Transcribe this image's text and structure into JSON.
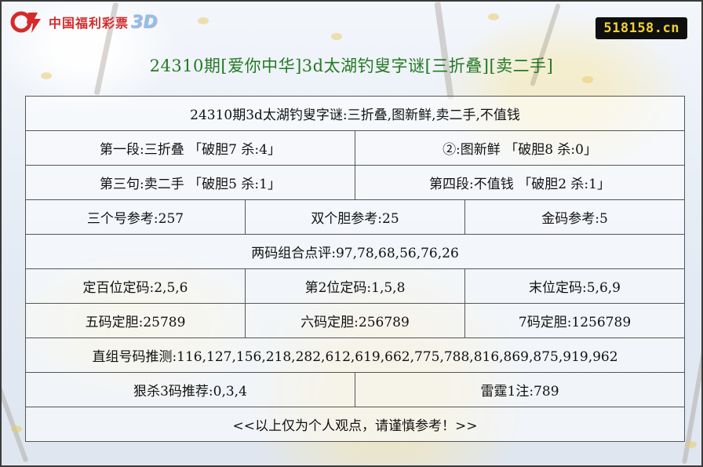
{
  "brand": {
    "logo_text": "中国福利彩票",
    "logo_3d": "3D",
    "site": "518158.cn"
  },
  "title": "24310期[爱你中华]3d太湖钓叟字谜[三折叠][卖二手]",
  "table": {
    "riddle": "24310期3d太湖钓叟字谜:三折叠,图新鲜,卖二手,不值钱",
    "line1": "第一段:三折叠 「破胆7 杀:4」",
    "line2": "②:图新鲜 「破胆8 杀:0」",
    "line3": "第三句:卖二手 「破胆5 杀:1」",
    "line4": "第四段:不值钱 「破胆2 杀:1」",
    "three_ref": "三个号参考:257",
    "double_ref": "双个胆参考:25",
    "gold_ref": "金码参考:5",
    "two_combo": "两码组合点评:97,78,68,56,76,26",
    "hundreds": "定百位定码:2,5,6",
    "second": "第2位定码:1,5,8",
    "last": "末位定码:5,6,9",
    "five_dan": "五码定胆:25789",
    "six_dan": "六码定胆:256789",
    "seven_dan": "7码定胆:1256789",
    "direct_group": "直组号码推测:116,127,156,218,282,612,619,662,775,788,816,869,875,919,962",
    "kill3": "狠杀3码推荐:0,3,4",
    "thunder": "雷霆1注:789",
    "disclaimer": "<<以上仅为个人观点，请谨慎参考！>>"
  }
}
